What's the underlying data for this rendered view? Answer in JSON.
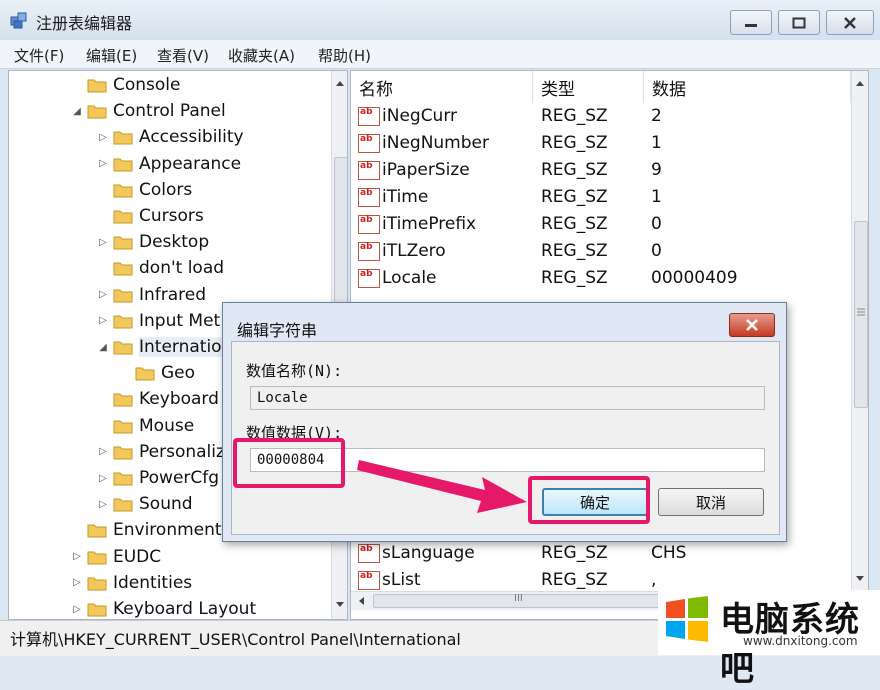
{
  "window": {
    "title": "注册表编辑器",
    "menu": [
      "文件(F)",
      "编辑(E)",
      "查看(V)",
      "收藏夹(A)",
      "帮助(H)"
    ]
  },
  "tree": {
    "items": [
      {
        "label": "Console",
        "level": 1,
        "expander": ""
      },
      {
        "label": "Control Panel",
        "level": 1,
        "expander": "◢"
      },
      {
        "label": "Accessibility",
        "level": 2,
        "expander": "▷"
      },
      {
        "label": "Appearance",
        "level": 2,
        "expander": "▷"
      },
      {
        "label": "Colors",
        "level": 2,
        "expander": ""
      },
      {
        "label": "Cursors",
        "level": 2,
        "expander": ""
      },
      {
        "label": "Desktop",
        "level": 2,
        "expander": "▷"
      },
      {
        "label": "don't load",
        "level": 2,
        "expander": ""
      },
      {
        "label": "Infrared",
        "level": 2,
        "expander": "▷"
      },
      {
        "label": "Input Met",
        "level": 2,
        "expander": "▷"
      },
      {
        "label": "Internation",
        "level": 2,
        "expander": "◢"
      },
      {
        "label": "Geo",
        "level": 3,
        "expander": ""
      },
      {
        "label": "Keyboard",
        "level": 2,
        "expander": ""
      },
      {
        "label": "Mouse",
        "level": 2,
        "expander": ""
      },
      {
        "label": "Personaliz",
        "level": 2,
        "expander": "▷"
      },
      {
        "label": "PowerCfg",
        "level": 2,
        "expander": "▷"
      },
      {
        "label": "Sound",
        "level": 2,
        "expander": "▷"
      },
      {
        "label": "Environment",
        "level": 1,
        "expander": ""
      },
      {
        "label": "EUDC",
        "level": 1,
        "expander": "▷"
      },
      {
        "label": "Identities",
        "level": 1,
        "expander": "▷"
      },
      {
        "label": "Keyboard Layout",
        "level": 1,
        "expander": "▷"
      }
    ]
  },
  "list": {
    "columns": [
      "名称",
      "类型",
      "数据"
    ],
    "rows": [
      {
        "name": "iNegCurr",
        "type": "REG_SZ",
        "data": "2"
      },
      {
        "name": "iNegNumber",
        "type": "REG_SZ",
        "data": "1"
      },
      {
        "name": "iPaperSize",
        "type": "REG_SZ",
        "data": "9"
      },
      {
        "name": "iTime",
        "type": "REG_SZ",
        "data": "1"
      },
      {
        "name": "iTimePrefix",
        "type": "REG_SZ",
        "data": "0"
      },
      {
        "name": "iTLZero",
        "type": "REG_SZ",
        "data": "0"
      },
      {
        "name": "Locale",
        "type": "REG_SZ",
        "data": "00000409"
      }
    ],
    "rows_below": [
      {
        "name": "sLanguage",
        "type": "REG_SZ",
        "data": "CHS"
      },
      {
        "name": "sList",
        "type": "REG_SZ",
        "data": ","
      }
    ],
    "hscroll_grip": "III"
  },
  "dialog": {
    "title": "编辑字符串",
    "name_label": "数值名称(N):",
    "name_value": "Locale",
    "data_label": "数值数据(V):",
    "data_value": "00000804",
    "ok": "确定",
    "cancel": "取消"
  },
  "status": {
    "path": "计算机\\HKEY_CURRENT_USER\\Control Panel\\International"
  },
  "watermark": {
    "name": "电脑系统吧",
    "url": "www.dnxitong.com"
  },
  "colors": {
    "highlight": "#e6186a",
    "folder": "#f2c85b"
  }
}
